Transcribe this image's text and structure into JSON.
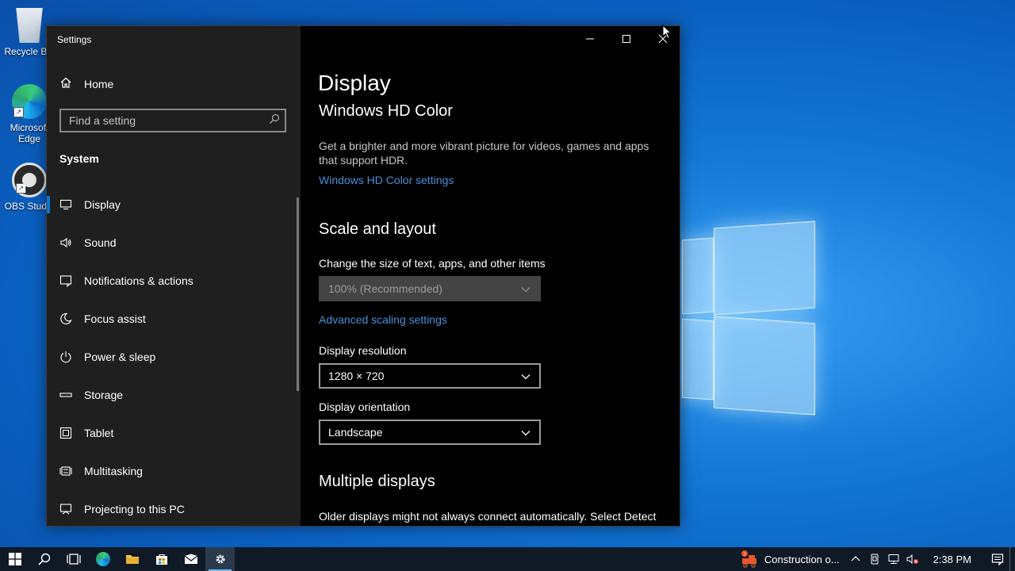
{
  "desktop": {
    "icons": [
      {
        "label": "Recycle Bin"
      },
      {
        "label": "Microsoft Edge"
      },
      {
        "label": "OBS Studio"
      }
    ]
  },
  "window": {
    "title": "Settings",
    "controls": {
      "minimize_icon": "minimize-icon",
      "maximize_icon": "maximize-icon",
      "close_icon": "close-icon"
    }
  },
  "nav": {
    "home_label": "Home",
    "search_placeholder": "Find a setting",
    "section_label": "System",
    "items": [
      {
        "label": "Display",
        "icon": "monitor-icon",
        "selected": true
      },
      {
        "label": "Sound",
        "icon": "speaker-icon"
      },
      {
        "label": "Notifications & actions",
        "icon": "notification-icon"
      },
      {
        "label": "Focus assist",
        "icon": "moon-icon"
      },
      {
        "label": "Power & sleep",
        "icon": "power-icon"
      },
      {
        "label": "Storage",
        "icon": "storage-icon"
      },
      {
        "label": "Tablet",
        "icon": "tablet-icon"
      },
      {
        "label": "Multitasking",
        "icon": "multitasking-icon"
      },
      {
        "label": "Projecting to this PC",
        "icon": "projecting-icon"
      }
    ]
  },
  "content": {
    "page_title": "Display",
    "hdr": {
      "heading": "Windows HD Color",
      "description": "Get a brighter and more vibrant picture for videos, games and apps that support HDR.",
      "link": "Windows HD Color settings"
    },
    "scale": {
      "heading": "Scale and layout",
      "size_label": "Change the size of text, apps, and other items",
      "size_value": "100% (Recommended)",
      "advanced_link": "Advanced scaling settings",
      "resolution_label": "Display resolution",
      "resolution_value": "1280 × 720",
      "orientation_label": "Display orientation",
      "orientation_value": "Landscape"
    },
    "multiple": {
      "heading": "Multiple displays",
      "description": "Older displays might not always connect automatically. Select Detect"
    }
  },
  "taskbar": {
    "tray_app_label": "Construction o...",
    "time": "2:38 PM"
  },
  "colors": {
    "accent": "#0a78d7",
    "link": "#4a90d9",
    "nav_bg": "#1f1f1f",
    "content_bg": "#000000",
    "taskbar_bg": "#101a26"
  }
}
